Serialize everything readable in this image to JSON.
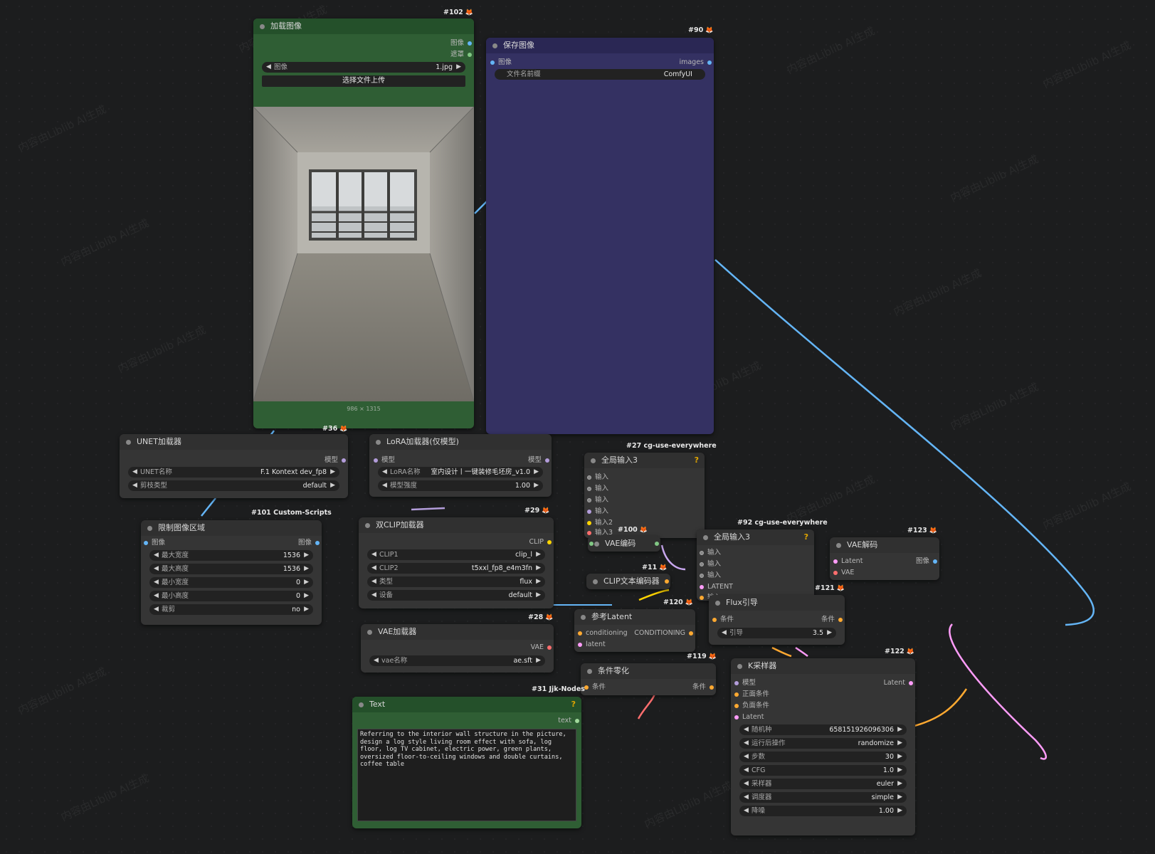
{
  "node_ids": {
    "n102": "#102",
    "n90": "#90",
    "n36": "#36",
    "n101": "#101 Custom-Scripts",
    "n27": "#27 cg-use-everywhere",
    "n29": "#29",
    "n100": "#100",
    "n92": "#92 cg-use-everywhere",
    "n123": "#123",
    "n11": "#11",
    "n121": "#121",
    "n120": "#120",
    "n28": "#28",
    "n119": "#119",
    "n122": "#122",
    "n31": "#31 Jjk-Nodes"
  },
  "load_image": {
    "title": "加载图像",
    "out_image": "图像",
    "out_mask": "遮罩",
    "image_label": "图像",
    "image_value": "1.jpg",
    "upload_button": "选择文件上传",
    "dimensions": "986 × 1315"
  },
  "save_image": {
    "title": "保存图像",
    "in_image": "图像",
    "out_images": "images",
    "prefix_label": "文件名前缀",
    "prefix_value": "ComfyUI"
  },
  "unet_loader": {
    "title": "UNET加载器",
    "out_model": "模型",
    "name_label": "UNET名称",
    "name_value": "F.1 Kontext dev_fp8",
    "dtype_label": "剪枝类型",
    "dtype_value": "default"
  },
  "lora_loader": {
    "title": "LoRA加载器(仅模型)",
    "in_model": "模型",
    "out_model": "模型",
    "name_label": "LoRA名称",
    "name_value": "室内设计丨一键装修毛坯房_v1.0",
    "strength_label": "模型强度",
    "strength_value": "1.00"
  },
  "limit_image": {
    "title": "限制图像区域",
    "in_image": "图像",
    "out_image": "图像",
    "rows": [
      {
        "label": "最大宽度",
        "value": "1536"
      },
      {
        "label": "最大高度",
        "value": "1536"
      },
      {
        "label": "最小宽度",
        "value": "0"
      },
      {
        "label": "最小高度",
        "value": "0"
      },
      {
        "label": "裁剪",
        "value": "no"
      }
    ]
  },
  "dual_clip": {
    "title": "双CLIP加载器",
    "out_clip": "CLIP",
    "rows": [
      {
        "label": "CLIP1",
        "value": "clip_l"
      },
      {
        "label": "CLIP2",
        "value": "t5xxl_fp8_e4m3fn"
      },
      {
        "label": "类型",
        "value": "flux"
      },
      {
        "label": "设备",
        "value": "default"
      }
    ]
  },
  "vae_loader": {
    "title": "VAE加载器",
    "out_vae": "VAE",
    "name_label": "vae名称",
    "name_value": "ae.sft"
  },
  "anywhere27": {
    "title": "全局输入3",
    "help": "?",
    "inputs": [
      "输入",
      "输入",
      "输入",
      "输入",
      "输入2",
      "输入3"
    ]
  },
  "vae_encode": {
    "title": "VAE编码"
  },
  "clip_text": {
    "title": "CLIP文本编码器"
  },
  "anywhere92": {
    "title": "全局输入3",
    "help": "?",
    "inputs": [
      "输入",
      "输入",
      "输入",
      "LATENT",
      "输入"
    ]
  },
  "vae_decode": {
    "title": "VAE解码",
    "in_latent": "Latent",
    "in_vae": "VAE",
    "out_image": "图像"
  },
  "flux_guide": {
    "title": "Flux引导",
    "in_cond": "条件",
    "out_cond": "条件",
    "guide_label": "引导",
    "guide_value": "3.5"
  },
  "ref_latent": {
    "title": "参考Latent",
    "in_cond": "conditioning",
    "in_latent": "latent",
    "out_cond": "CONDITIONING"
  },
  "cond_zero": {
    "title": "条件零化",
    "in_cond": "条件",
    "out_cond": "条件"
  },
  "ksampler": {
    "title": "K采样器",
    "inputs": [
      "模型",
      "正面条件",
      "负面条件",
      "Latent"
    ],
    "out_latent": "Latent",
    "rows": [
      {
        "label": "随机种",
        "value": "658151926096306"
      },
      {
        "label": "运行后操作",
        "value": "randomize"
      },
      {
        "label": "步数",
        "value": "30"
      },
      {
        "label": "CFG",
        "value": "1.0"
      },
      {
        "label": "采样器",
        "value": "euler"
      },
      {
        "label": "调度器",
        "value": "simple"
      },
      {
        "label": "降噪",
        "value": "1.00"
      }
    ]
  },
  "text_node": {
    "title": "Text",
    "help": "?",
    "out_text": "text",
    "content": "Referring to the interior wall structure in the picture, design a log style living room effect with sofa, log floor, log TV cabinet, electric power, green plants, oversized floor-to-ceiling windows and double curtains, coffee table"
  },
  "watermark": "内容由Liblib AI生成",
  "colors": {
    "image": "#64b5f6",
    "mask": "#81c784",
    "model": "#b39ddb",
    "clip": "#ffd500",
    "vae": "#ff6e6e",
    "latent": "#ff9cf9",
    "conditioning": "#ffa931",
    "text": "#a1d99b"
  }
}
